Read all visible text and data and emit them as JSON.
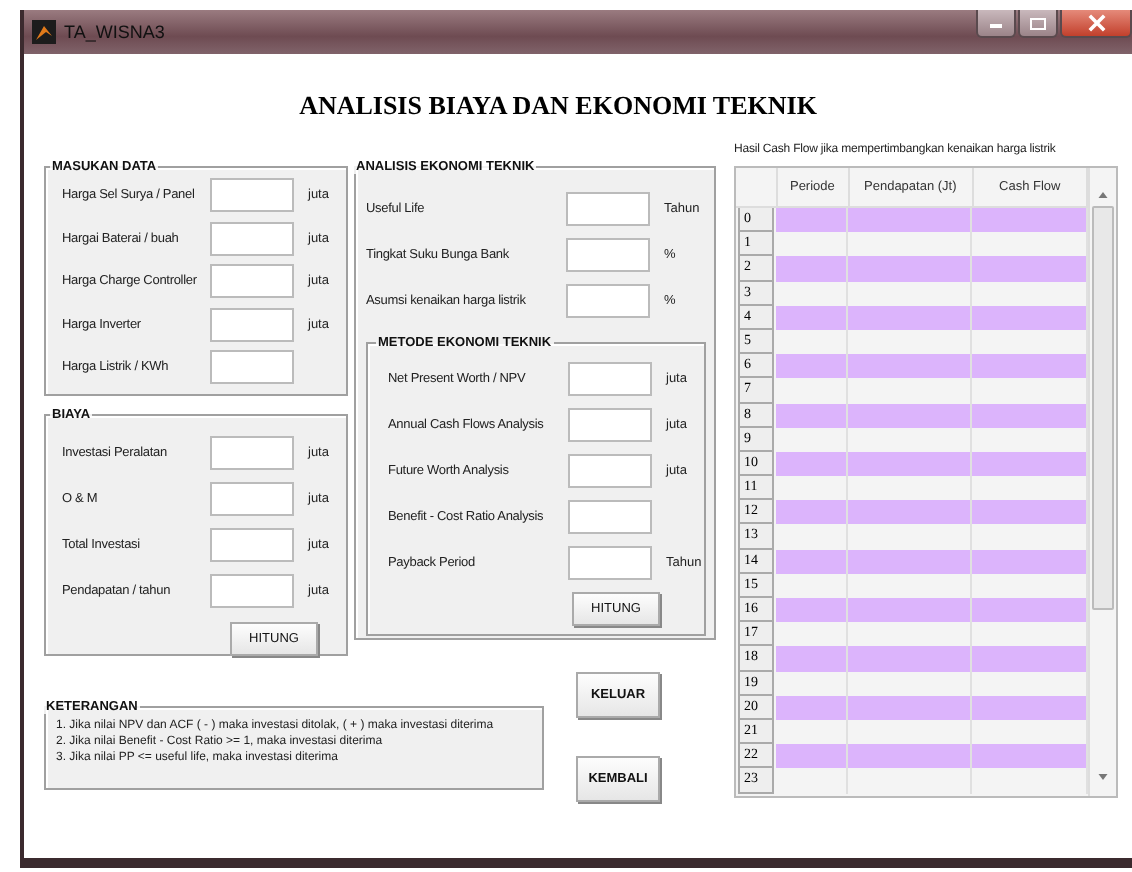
{
  "window": {
    "title": "TA_WISNA3"
  },
  "heading": "ANALISIS BIAYA DAN EKONOMI TEKNIK",
  "masukan_data": {
    "title": "MASUKAN DATA",
    "fields": [
      {
        "label": "Harga Sel Surya / Panel",
        "unit": "juta"
      },
      {
        "label": "Hargai Baterai / buah",
        "unit": "juta"
      },
      {
        "label": "Harga Charge Controller",
        "unit": "juta"
      },
      {
        "label": "Harga Inverter",
        "unit": "juta"
      },
      {
        "label": "Harga Listrik / KWh"
      }
    ]
  },
  "biaya": {
    "title": "BIAYA",
    "fields": [
      {
        "label": "Investasi Peralatan",
        "unit": "juta"
      },
      {
        "label": "O & M",
        "unit": "juta"
      },
      {
        "label": "Total Investasi",
        "unit": "juta"
      },
      {
        "label": "Pendapatan / tahun",
        "unit": "juta"
      }
    ],
    "button": "HITUNG"
  },
  "analisis": {
    "title": "ANALISIS EKONOMI TEKNIK",
    "fields": [
      {
        "label": "Useful Life",
        "unit": "Tahun"
      },
      {
        "label": "Tingkat Suku Bunga Bank",
        "unit": "%"
      },
      {
        "label": "Asumsi kenaikan harga listrik",
        "unit": "%"
      }
    ],
    "metode": {
      "title": "METODE EKONOMI TEKNIK",
      "fields": [
        {
          "label": "Net Present Worth / NPV",
          "unit": "juta"
        },
        {
          "label": "Annual Cash Flows Analysis",
          "unit": "juta"
        },
        {
          "label": "Future Worth Analysis",
          "unit": "juta"
        },
        {
          "label": "Benefit - Cost Ratio Analysis"
        },
        {
          "label": "Payback Period",
          "unit": "Tahun"
        }
      ],
      "button": "HITUNG"
    }
  },
  "table": {
    "caption": "Hasil Cash Flow jika mempertimbangkan kenaikan harga listrik",
    "columns": [
      "Periode",
      "Pendapatan (Jt)",
      "Cash Flow"
    ],
    "rows": [
      {
        "label": "0",
        "highlighted": true
      },
      {
        "label": "1",
        "highlighted": false
      },
      {
        "label": "2",
        "highlighted": true
      },
      {
        "label": "3",
        "highlighted": false
      },
      {
        "label": "4",
        "highlighted": true
      },
      {
        "label": "5",
        "highlighted": false
      },
      {
        "label": "6",
        "highlighted": true
      },
      {
        "label": "7",
        "highlighted": false
      },
      {
        "label": "8",
        "highlighted": true
      },
      {
        "label": "9",
        "highlighted": false
      },
      {
        "label": "10",
        "highlighted": true
      },
      {
        "label": "11",
        "highlighted": false
      },
      {
        "label": "12",
        "highlighted": true
      },
      {
        "label": "13",
        "highlighted": false
      },
      {
        "label": "14",
        "highlighted": true
      },
      {
        "label": "15",
        "highlighted": false
      },
      {
        "label": "16",
        "highlighted": true
      },
      {
        "label": "17",
        "highlighted": false
      },
      {
        "label": "18",
        "highlighted": true
      },
      {
        "label": "19",
        "highlighted": false
      },
      {
        "label": "20",
        "highlighted": true
      },
      {
        "label": "21",
        "highlighted": false
      },
      {
        "label": "22",
        "highlighted": true
      },
      {
        "label": "23",
        "highlighted": false
      }
    ]
  },
  "keterangan": {
    "title": "KETERANGAN",
    "lines": [
      "1. Jika nilai NPV dan ACF ( - ) maka investasi ditolak, ( + ) maka investasi diterima",
      "2. Jika nilai Benefit - Cost Ratio >= 1, maka investasi diterima",
      "3. Jika nilai PP <= useful life, maka investasi diterima"
    ]
  },
  "buttons": [
    "KELUAR",
    "KEMBALI"
  ]
}
